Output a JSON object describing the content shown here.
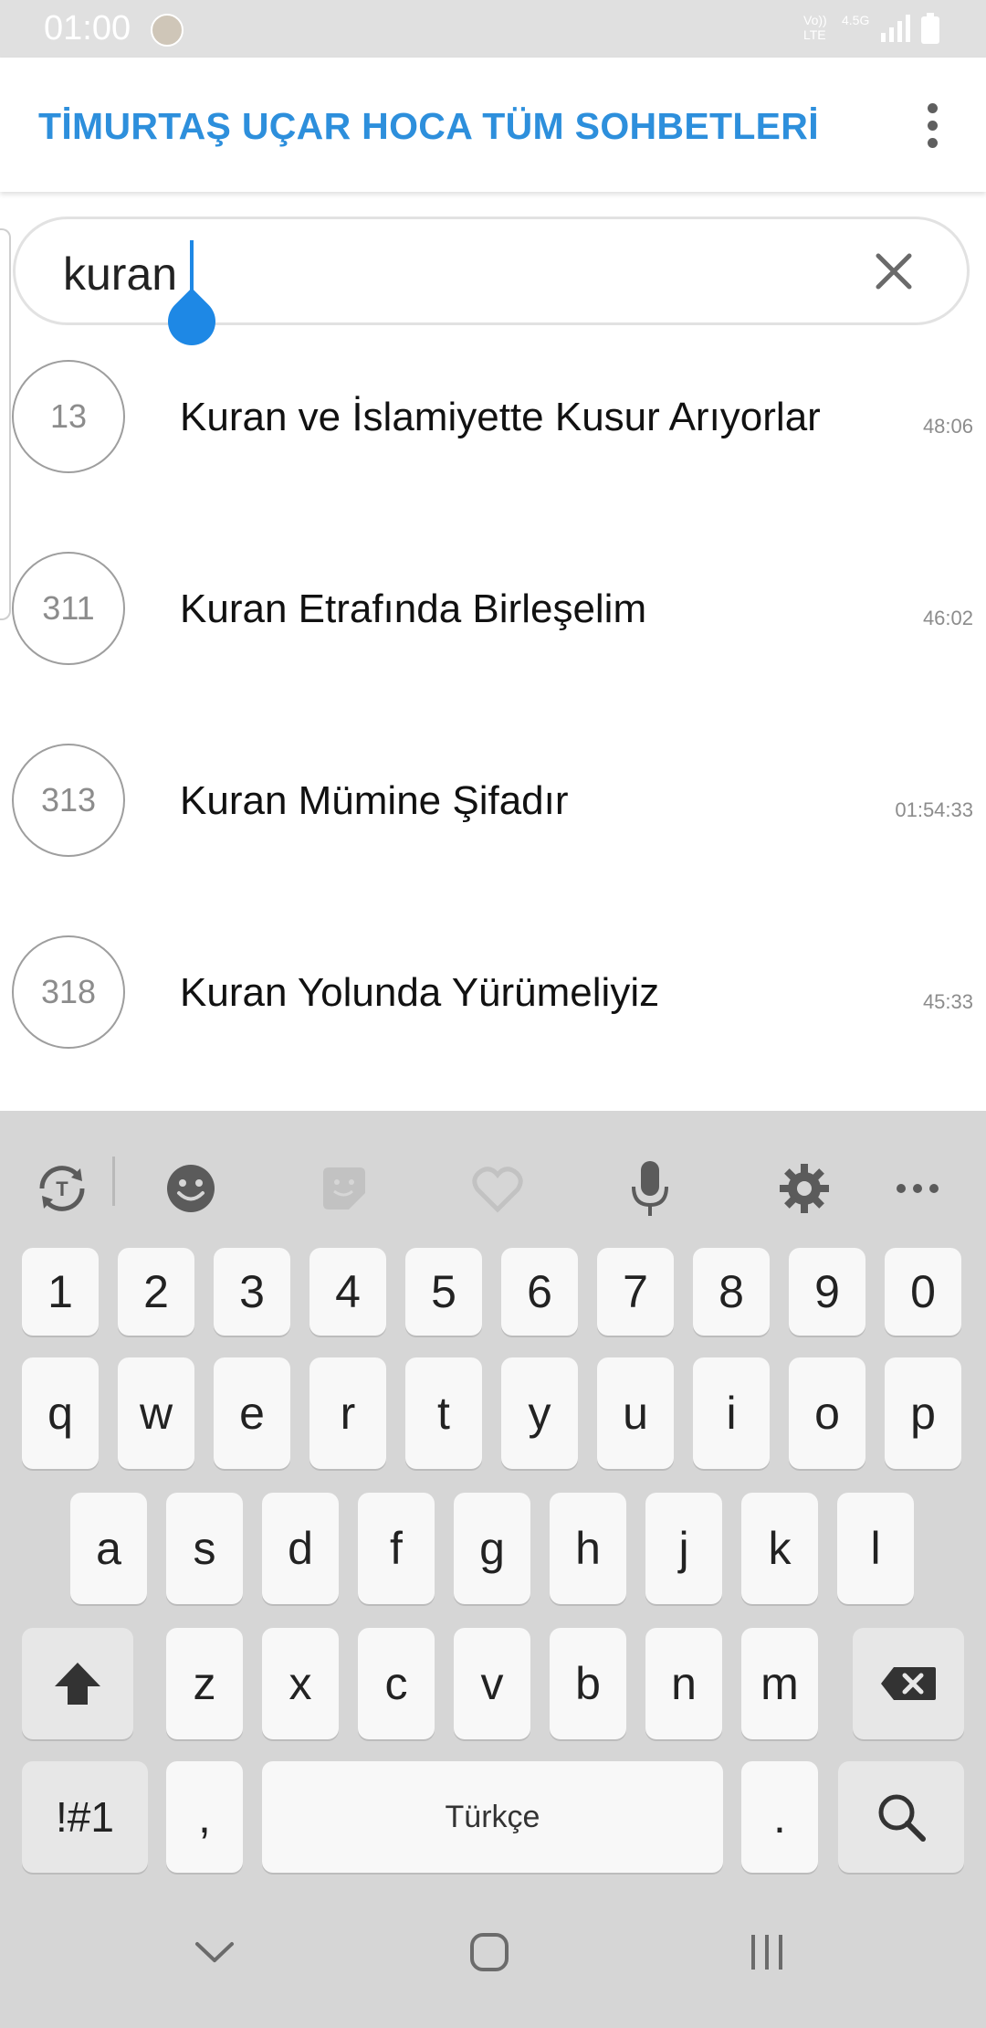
{
  "status_bar": {
    "time": "01:00",
    "network_top": "Vo))",
    "network_bottom": "LTE",
    "net_speed": "4.5G"
  },
  "app_bar": {
    "title": "TİMURTAŞ UÇAR HOCA TÜM SOHBETLERİ",
    "menu_icon": "more-vert-icon"
  },
  "search": {
    "value": "kuran",
    "clear_icon": "close-icon"
  },
  "results": [
    {
      "number": "13",
      "title": "Kuran ve İslamiyette Kusur Arıyorlar",
      "duration": "48:06"
    },
    {
      "number": "311",
      "title": "Kuran Etrafında Birleşelim",
      "duration": "46:02"
    },
    {
      "number": "313",
      "title": "Kuran Mümine Şifadır",
      "duration": "01:54:33"
    },
    {
      "number": "318",
      "title": "Kuran Yolunda Yürümeliyiz",
      "duration": "45:33"
    }
  ],
  "keyboard": {
    "toolbar": [
      "translate-icon",
      "emoji-icon",
      "sticker-icon",
      "bitmoji-icon",
      "mic-icon",
      "settings-icon",
      "more-horiz-icon"
    ],
    "row_numbers": [
      "1",
      "2",
      "3",
      "4",
      "5",
      "6",
      "7",
      "8",
      "9",
      "0"
    ],
    "row_1": [
      "q",
      "w",
      "e",
      "r",
      "t",
      "y",
      "u",
      "i",
      "o",
      "p"
    ],
    "row_2": [
      "a",
      "s",
      "d",
      "f",
      "g",
      "h",
      "j",
      "k",
      "l"
    ],
    "row_3": [
      "z",
      "x",
      "c",
      "v",
      "b",
      "n",
      "m"
    ],
    "symbols_label": "!#1",
    "comma_label": ",",
    "space_label": "Türkçe",
    "period_label": ".",
    "search_key_icon": "search-icon"
  },
  "nav_bar": [
    "hide-keyboard-icon",
    "home-icon",
    "recents-icon"
  ],
  "colors": {
    "accent": "#2d8fdc",
    "caret": "#1e88e5",
    "keyboard_bg": "#d6d6d6"
  }
}
